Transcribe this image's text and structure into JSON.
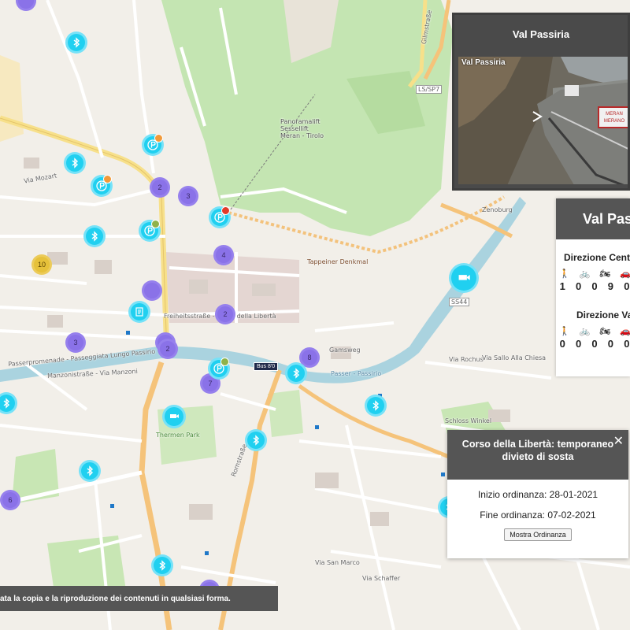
{
  "map": {
    "labels": [
      {
        "text": "Via Mozart",
        "key": "l1"
      },
      {
        "text": "Freiheitsstraße - Corso della Libertà",
        "key": "l2"
      },
      {
        "text": "Passerpromenade - Passeggiata Lungo Passirio",
        "key": "l3"
      },
      {
        "text": "Manzonistraße - Via Manzoni",
        "key": "l4"
      },
      {
        "text": "Thermen Park",
        "key": "l5"
      },
      {
        "text": "Tappeiner Denkmal",
        "key": "l6"
      },
      {
        "text": "Panoramalift Sessellift Meran - Tirolo",
        "key": "l7"
      },
      {
        "text": "Zenoburg",
        "key": "l8"
      },
      {
        "text": "Schloss Winkel",
        "key": "l9"
      },
      {
        "text": "Passer - Passirio",
        "key": "l10"
      },
      {
        "text": "Romstraße",
        "key": "l11"
      },
      {
        "text": "Via San Marco",
        "key": "l12"
      },
      {
        "text": "Gilmstraße",
        "key": "l13"
      },
      {
        "text": "LS/SP7",
        "key": "l14"
      },
      {
        "text": "SS44",
        "key": "l15"
      },
      {
        "text": "Via Schaffer",
        "key": "l16"
      },
      {
        "text": "Via Rochus",
        "key": "l17"
      },
      {
        "text": "Via Sallo Alla Chiesa",
        "key": "l18"
      },
      {
        "text": "Gamsweg",
        "key": "l19"
      }
    ],
    "clusters": [
      "2",
      "3",
      "4",
      "2",
      "2",
      "3",
      "2",
      "8",
      "7",
      "6",
      "3",
      "10"
    ],
    "bus_badge": "Bus 8'0"
  },
  "webcam": {
    "title": "Val Passiria",
    "cam_label": "Val Passiria",
    "sign_text": "MERAN MERANO"
  },
  "counter": {
    "title": "Val Passiria",
    "direction1": "Direzione Centro",
    "direction2": "Direzione Val Passiria",
    "icons": [
      "pedestrian-icon",
      "bicycle-icon",
      "motorcycle-icon",
      "car-icon",
      "truck-icon"
    ],
    "values1": [
      "1",
      "0",
      "0",
      "9",
      "0"
    ],
    "values2": [
      "0",
      "0",
      "0",
      "0",
      "0"
    ]
  },
  "popup": {
    "title": "Corso della Libertà: temporaneo divieto di sosta",
    "start_label": "Inizio ordinanza:",
    "start_date": "28-01-2021",
    "end_label": "Fine ordinanza:",
    "end_date": "07-02-2021",
    "button": "Mostra Ordinanza",
    "close": "✕"
  },
  "notice": "ata la copia e la riproduzione dei contenuti in qualsiasi forma.",
  "colors": {
    "cluster": "#8a72e8",
    "bluetooth_marker": "#20d0f0",
    "park": "#c8e6b4",
    "river": "#aad3df",
    "panel": "#555555"
  }
}
